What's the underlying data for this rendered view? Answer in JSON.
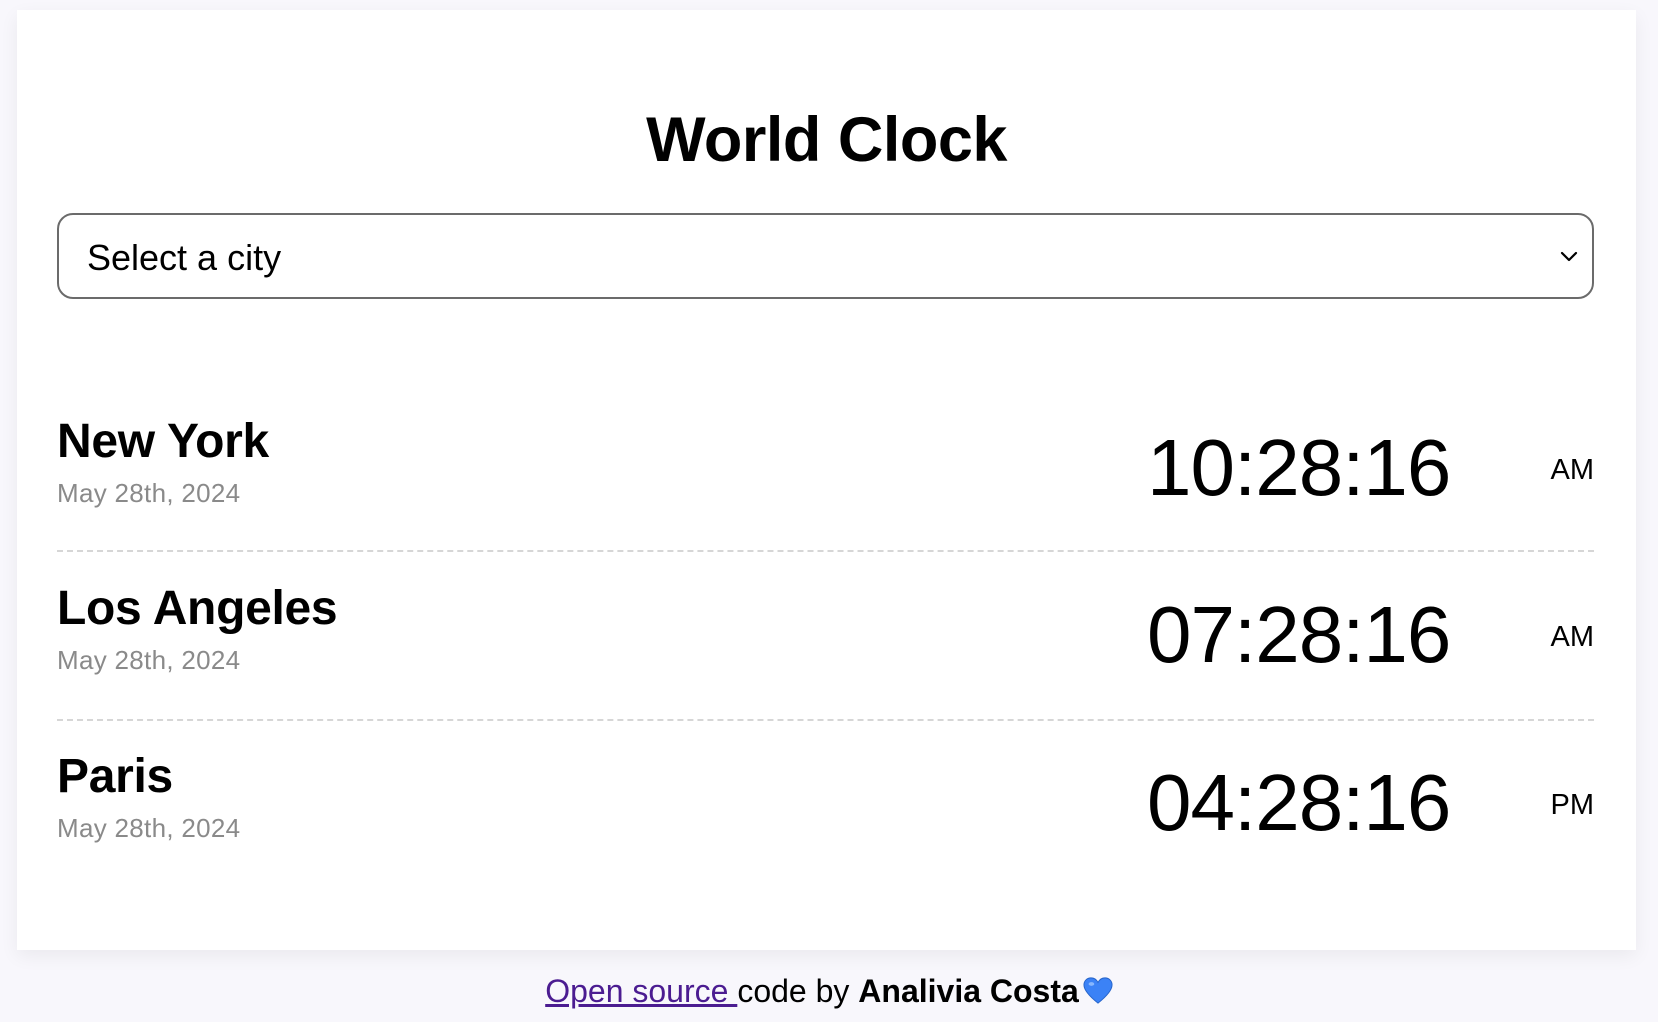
{
  "header": {
    "title": "World Clock"
  },
  "city_select": {
    "selected_value": "Select a city",
    "icon": "chevron-down-icon"
  },
  "clocks": [
    {
      "city": "New York",
      "date": "May 28th, 2024",
      "time": "10:28:16",
      "period": "AM"
    },
    {
      "city": "Los Angeles",
      "date": "May 28th, 2024",
      "time": "07:28:16",
      "period": "AM"
    },
    {
      "city": "Paris",
      "date": "May 28th, 2024",
      "time": "04:28:16",
      "period": "PM"
    }
  ],
  "footer": {
    "link_text": "Open source ",
    "text": "code by ",
    "author": "Analivia Costa",
    "icon": "blue-heart-icon"
  },
  "colors": {
    "background": "#f8f7fc",
    "card": "#ffffff",
    "date_text": "#8a8a8a",
    "link": "#4b1c91",
    "heart": "#3b82f6",
    "divider": "#d6d6d6"
  }
}
